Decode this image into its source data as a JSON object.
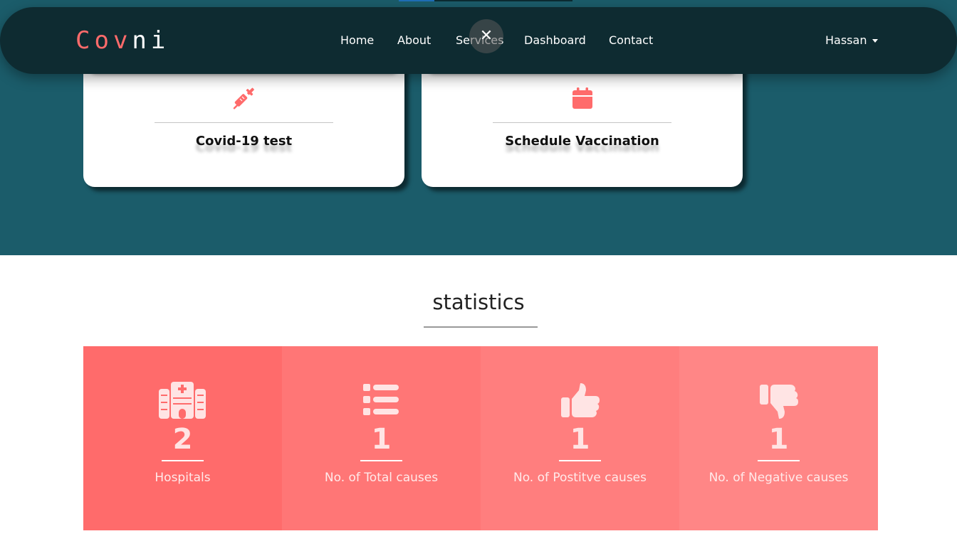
{
  "colors": {
    "hero_background": "#1b5c6a",
    "navbar_background": "#0e2b31",
    "accent": "#ff6b6b",
    "stat_backgrounds": [
      "#ff6b6b",
      "#ff7676",
      "#ff7e7e",
      "#ff8686"
    ]
  },
  "brand": {
    "accent_text": "Cov",
    "rest_text": "ni"
  },
  "nav": {
    "links": [
      {
        "label": "Home"
      },
      {
        "label": "About"
      },
      {
        "label": "Services"
      },
      {
        "label": "Dashboard"
      },
      {
        "label": "Contact"
      }
    ],
    "close_icon_label": "✕",
    "user": {
      "name": "Hassan"
    }
  },
  "services": {
    "cards": [
      {
        "icon": "syringe-icon",
        "title": "Covid-19 test"
      },
      {
        "icon": "calendar-icon",
        "title": "Schedule Vaccination"
      }
    ]
  },
  "statistics": {
    "title": "statistics",
    "items": [
      {
        "icon": "hospital-icon",
        "value": "2",
        "label": "Hospitals"
      },
      {
        "icon": "list-icon",
        "value": "1",
        "label": "No. of Total causes"
      },
      {
        "icon": "thumbs-up-icon",
        "value": "1",
        "label": "No. of Postitve causes"
      },
      {
        "icon": "thumbs-down-icon",
        "value": "1",
        "label": "No. of Negative causes"
      }
    ]
  }
}
